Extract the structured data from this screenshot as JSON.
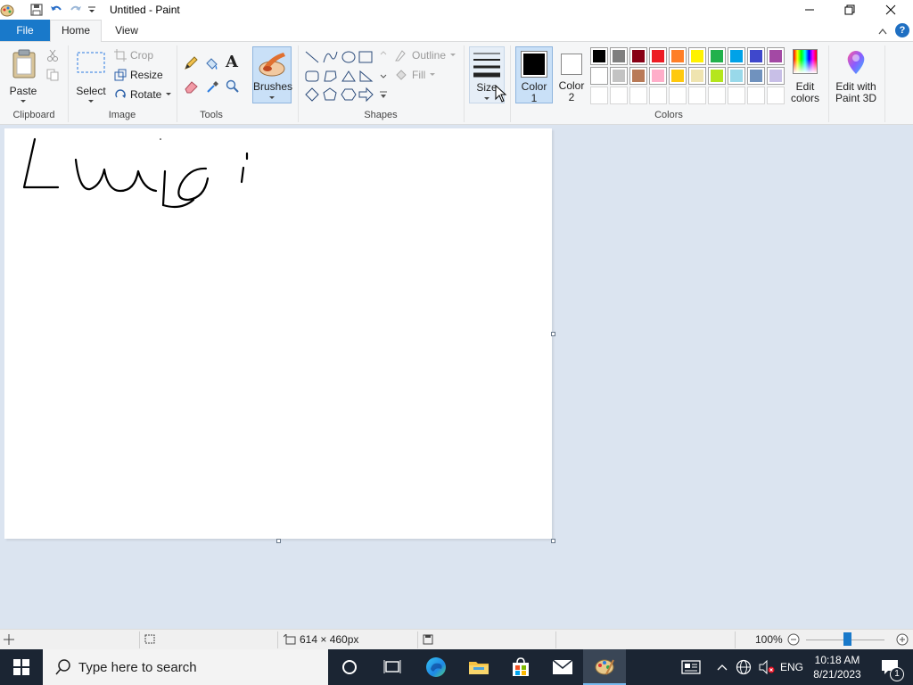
{
  "window": {
    "title": "Untitled - Paint"
  },
  "tabs": {
    "file": "File",
    "home": "Home",
    "view": "View"
  },
  "ribbon": {
    "clipboard": {
      "paste": "Paste",
      "group": "Clipboard"
    },
    "image": {
      "select": "Select",
      "crop": "Crop",
      "resize": "Resize",
      "rotate": "Rotate",
      "group": "Image"
    },
    "tools": {
      "group": "Tools"
    },
    "brushes": {
      "label": "Brushes"
    },
    "shapes": {
      "outline": "Outline",
      "fill": "Fill",
      "group": "Shapes"
    },
    "size": {
      "label": "Size"
    },
    "colors": {
      "color1_label": "Color",
      "color1_num": "1",
      "color2_label": "Color",
      "color2_num": "2",
      "color1": "#000000",
      "color2": "#ffffff",
      "edit_label": "Edit",
      "edit_label2": "colors",
      "paint3d_label": "Edit with",
      "paint3d_label2": "Paint 3D",
      "group": "Colors",
      "palette_row1": [
        "#000000",
        "#7f7f7f",
        "#880015",
        "#ed1c24",
        "#ff7f27",
        "#fff200",
        "#22b14c",
        "#00a2e8",
        "#3f48cc",
        "#a349a4"
      ],
      "palette_row2": [
        "#ffffff",
        "#c3c3c3",
        "#b97a57",
        "#ffaec9",
        "#ffc90e",
        "#efe4b0",
        "#b5e61d",
        "#99d9ea",
        "#7092be",
        "#c8bfe7"
      ],
      "palette_row3": [
        "#ffffff",
        "#ffffff",
        "#ffffff",
        "#ffffff",
        "#ffffff",
        "#ffffff",
        "#ffffff",
        "#ffffff",
        "#ffffff",
        "#ffffff"
      ]
    }
  },
  "status": {
    "canvas_size": "614 × 460px",
    "zoom": "100%"
  },
  "taskbar": {
    "search_placeholder": "Type here to search",
    "lang": "ENG",
    "time": "10:18 AM",
    "date": "8/21/2023",
    "notification_count": "1"
  }
}
